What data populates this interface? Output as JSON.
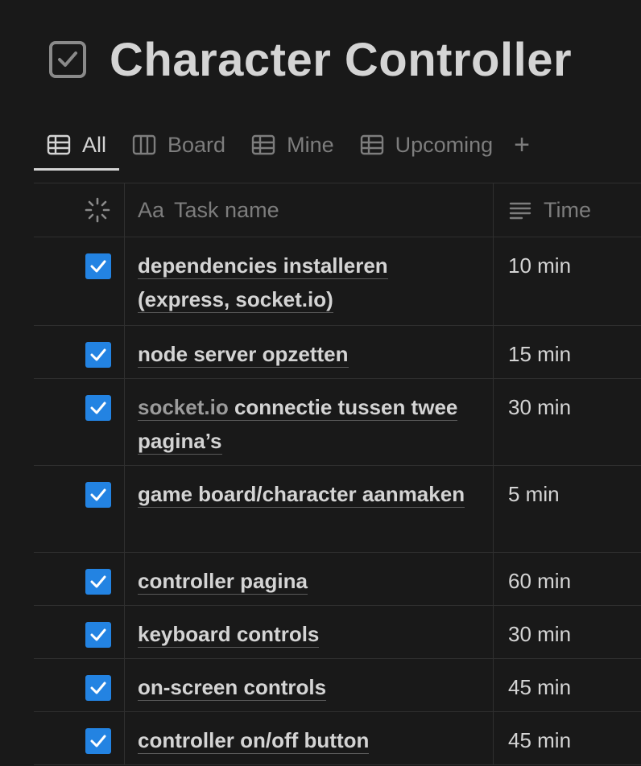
{
  "page": {
    "title": "Character Controller",
    "title_icon": "checkbox-icon"
  },
  "tabs": [
    {
      "label": "All",
      "icon": "table-icon",
      "active": true
    },
    {
      "label": "Board",
      "icon": "board-icon",
      "active": false
    },
    {
      "label": "Mine",
      "icon": "table-icon",
      "active": false
    },
    {
      "label": "Upcoming",
      "icon": "table-icon",
      "active": false
    }
  ],
  "add_tab_label": "+",
  "table": {
    "headers": {
      "check_icon": "status-spinner-icon",
      "name_prefix": "Aa",
      "name": "Task name",
      "time_icon": "text-lines-icon",
      "time": "Time"
    },
    "rows": [
      {
        "checked": true,
        "name": "dependencies installeren (express, socket.io)",
        "time": "10 min"
      },
      {
        "checked": true,
        "name": "node server opzetten",
        "time": "15 min"
      },
      {
        "checked": true,
        "name_link": "socket.io",
        "name": " connectie tussen twee pagina’s",
        "time": "30 min"
      },
      {
        "checked": true,
        "name": "game board/character aanmaken",
        "time": "5 min"
      },
      {
        "checked": true,
        "name": "controller pagina",
        "time": "60 min"
      },
      {
        "checked": true,
        "name": "keyboard controls",
        "time": "30 min"
      },
      {
        "checked": true,
        "name": "on-screen controls",
        "time": "45 min"
      },
      {
        "checked": true,
        "name": "controller on/off button",
        "time": "45 min"
      }
    ]
  },
  "colors": {
    "background": "#191919",
    "text": "#d4d4d4",
    "muted": "#7d7d7d",
    "checkbox": "#2383e2"
  }
}
